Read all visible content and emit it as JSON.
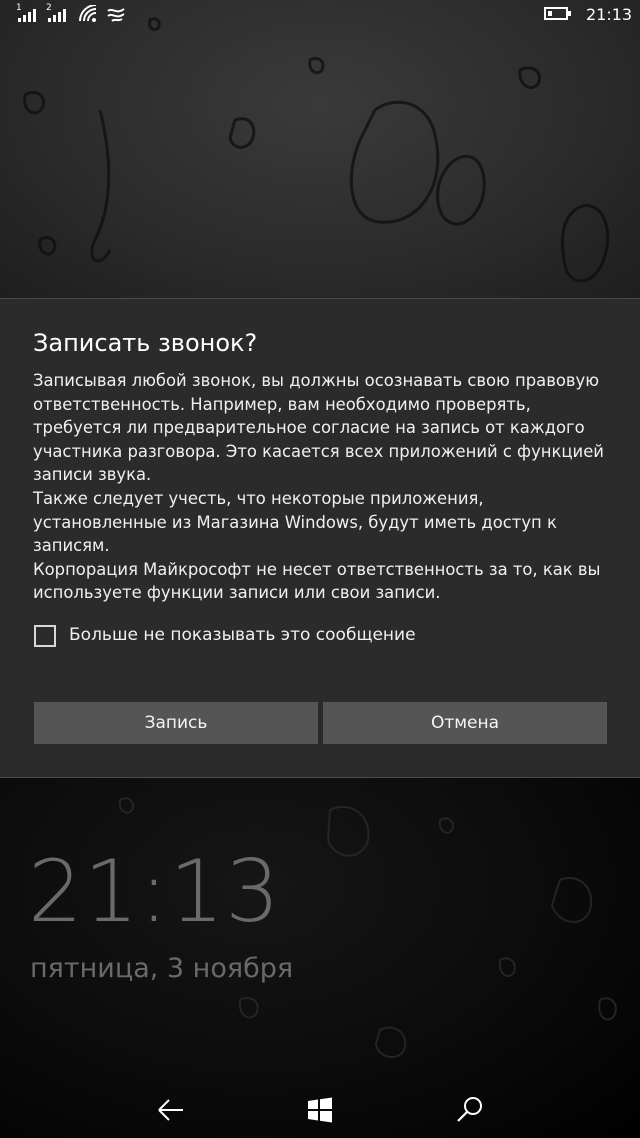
{
  "status_bar": {
    "sim1": "1",
    "sim2": "2",
    "time": "21:13",
    "icons": [
      "signal-icon",
      "signal-icon",
      "wifi-icon",
      "hotspot-icon",
      "battery-icon"
    ],
    "battery_level": 0.25
  },
  "dialog": {
    "title": "Записать звонок?",
    "paragraphs": [
      "Записывая любой звонок, вы должны осознавать свою правовую ответственность. Например, вам необходимо проверять, требуется ли предварительное согласие на запись от каждого участника разговора. Это касается всех приложений с функцией записи звука.",
      "Также следует учесть, что некоторые приложения, установленные из Магазина Windows, будут иметь доступ к записям.",
      "Корпорация Майкрософт не несет ответственность за то, как вы используете функции записи или свои записи."
    ],
    "checkbox_label": "Больше не показывать это сообщение",
    "checkbox_checked": false,
    "record_button": "Запись",
    "cancel_button": "Отмена"
  },
  "lock_screen": {
    "time": "21:13",
    "date": "пятница, 3 ноября"
  },
  "nav_bar": {
    "icons": [
      "back-arrow-icon",
      "windows-logo-icon",
      "search-icon"
    ]
  },
  "colors": {
    "dialog_bg": "#2b2b2b",
    "button_bg": "#555555",
    "lock_text": "#6a6a6a"
  }
}
